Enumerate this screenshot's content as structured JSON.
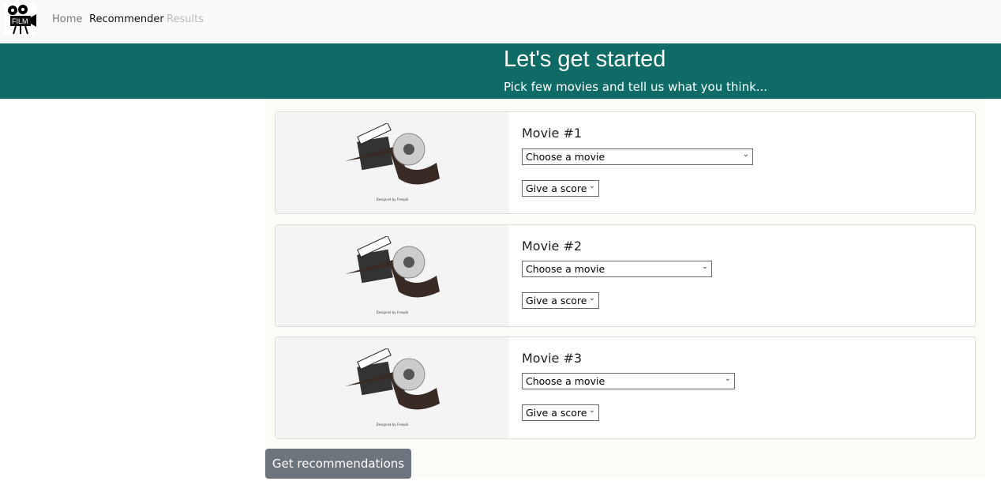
{
  "nav": {
    "logo_text": "FILM",
    "links": [
      {
        "label": "Home"
      },
      {
        "label": "Recommender"
      },
      {
        "label": "Results"
      }
    ]
  },
  "banner": {
    "title": "Let's get started",
    "subtitle": "Pick few movies and tell us what you think..."
  },
  "image_credit": "Designed by Freepik",
  "movies": [
    {
      "title": "Movie #1",
      "movie_select": "Choose a movie",
      "score_select": "Give a score"
    },
    {
      "title": "Movie #2",
      "movie_select": "Choose a movie",
      "score_select": "Give a score"
    },
    {
      "title": "Movie #3",
      "movie_select": "Choose a movie",
      "score_select": "Give a score"
    }
  ],
  "submit_label": "Get recommendations"
}
